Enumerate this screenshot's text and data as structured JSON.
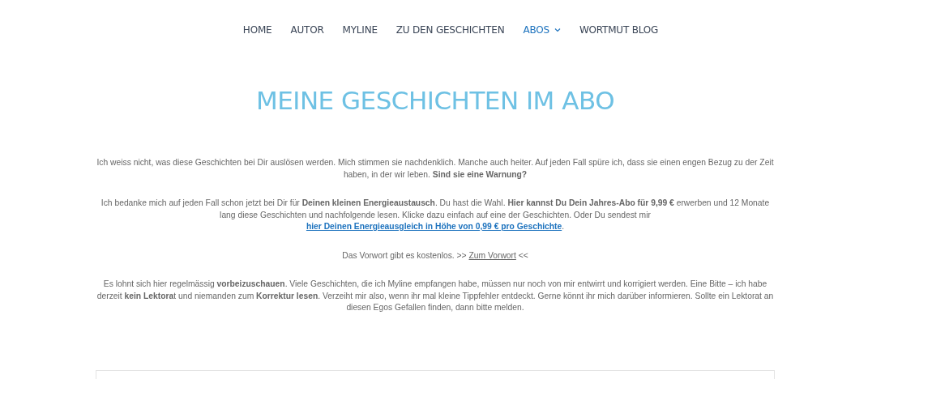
{
  "nav": [
    {
      "label": "HOME",
      "selected": false
    },
    {
      "label": "AUTOR",
      "selected": false
    },
    {
      "label": "MYLINE",
      "selected": false
    },
    {
      "label": "ZU DEN GESCHICHTEN",
      "selected": false
    },
    {
      "label": "ABOS",
      "selected": true,
      "dropdown": true
    },
    {
      "label": "WORTMUT BLOG",
      "selected": false
    }
  ],
  "heading": "MEINE GESCHICHTEN IM ABO",
  "paragraphs": [
    {
      "parts": [
        {
          "kind": "text",
          "text": "Ich weiss nicht, was diese Geschichten bei Dir auslösen werden. Mich stimmen sie nachdenklich. Manche auch heiter. Auf jeden Fall spüre ich, dass sie einen engen Bezug zu der Zeit haben, in der wir leben. **Sind sie eine Warnung?**"
        }
      ]
    },
    {
      "parts": [
        {
          "kind": "text",
          "text": "Ich bedanke mich auf jeden Fall schon jetzt bei Dir für **Deinen kleinen Energieaustausch**. Du hast die Wahl. **Hier kannst Du Dein Jahres-Abo für 9,99 €** erwerben und 12 Monate lang diese Geschichten und nachfolgende lesen. Klicke dazu einfach auf eine der Geschichten. Oder Du sendest mir "
        },
        {
          "kind": "accent-link",
          "text": "hier Deinen Energieausgleich in Höhe von 0,99 € pro Geschichte"
        },
        {
          "kind": "text",
          "text": "."
        }
      ]
    },
    {
      "parts": [
        {
          "kind": "text",
          "text": "Das Vorwort gibt es kostenlos. >> "
        },
        {
          "kind": "link",
          "text": "Zum Vorwort"
        },
        {
          "kind": "text",
          "text": " <<"
        }
      ]
    },
    {
      "parts": [
        {
          "kind": "text",
          "text": "Es lohnt sich hier regelmässig **vorbeizuschauen**. Viele Geschichten, die ich Myline empfangen habe, müssen nur noch von mir entwirrt und korrigiert werden. Eine Bitte – ich habe derzeit **kein Lektora**t und niemanden zum **Korrektur lesen**. Verzeiht mir also, wenn ihr mal kleine Tippfehler entdeckt. Gerne könnt ihr mich darüber informieren. Sollte ein Lektorat an diesen Egos Gefallen finden, dann bitte melden."
        }
      ]
    }
  ]
}
